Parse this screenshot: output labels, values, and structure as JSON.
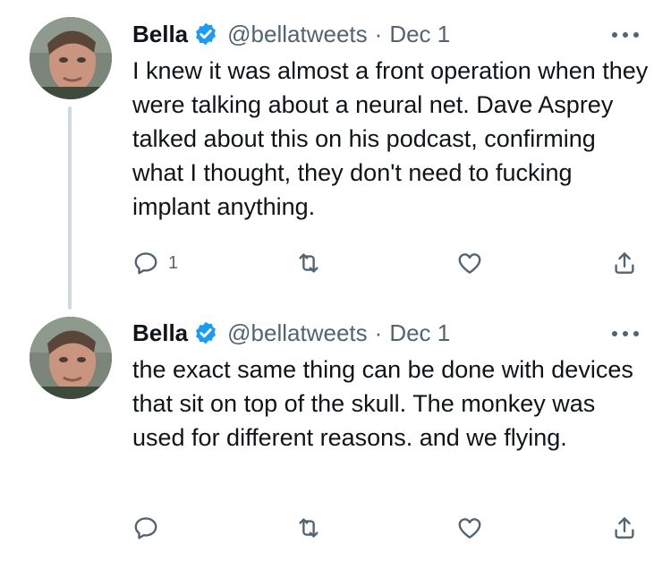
{
  "tweets": [
    {
      "name": "Bella",
      "handle": "@bellatweets",
      "separator": "·",
      "date": "Dec 1",
      "text": "I knew it was almost a front operation when they were talking about a neural net. Dave Asprey talked about this on his podcast, confirming what I thought, they don't need to fucking implant anything.",
      "reply_count": "1"
    },
    {
      "name": "Bella",
      "handle": "@bellatweets",
      "separator": "·",
      "date": "Dec 1",
      "text": "the exact same thing can be done with devices that sit on top of the skull. The monkey was used for different reasons. and we flying.",
      "reply_count": ""
    }
  ],
  "icons": {
    "verified": "verified-badge-icon",
    "more": "more-dots-icon",
    "reply": "reply-icon",
    "retweet": "retweet-icon",
    "like": "heart-icon",
    "share": "share-icon"
  },
  "colors": {
    "text": "#0f1419",
    "secondary": "#536471",
    "verified": "#1d9bf0",
    "thread_line": "#cfd9de"
  }
}
